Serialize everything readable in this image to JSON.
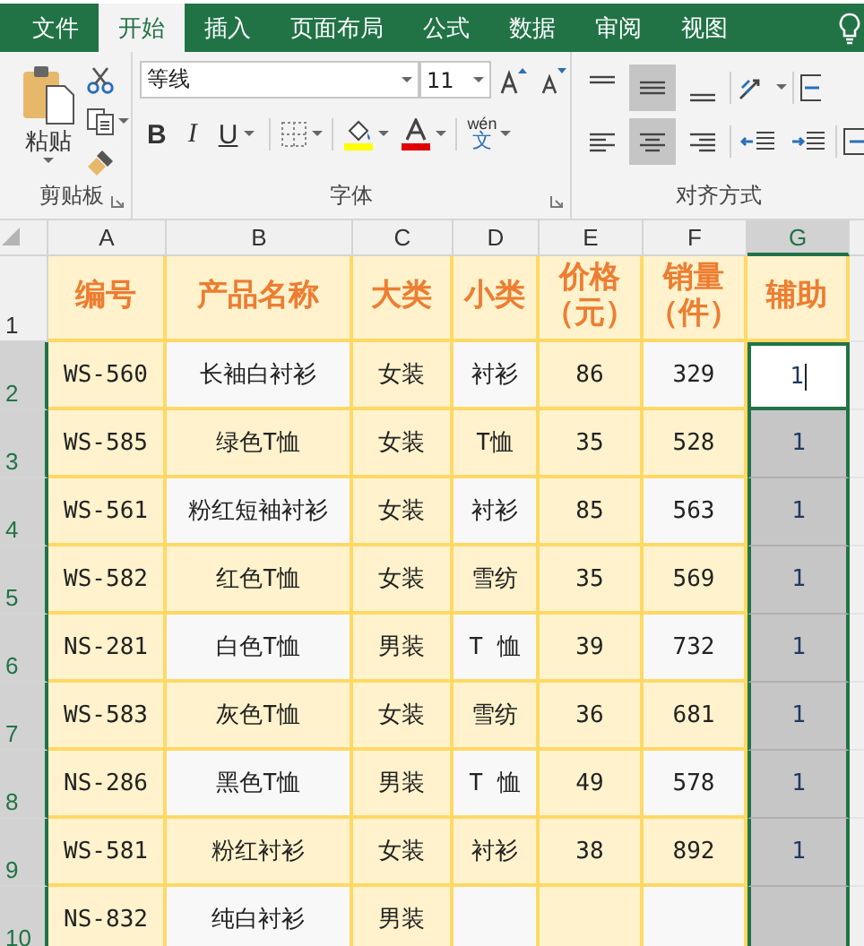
{
  "ribbon_tabs": [
    {
      "label": "文件",
      "selected": false
    },
    {
      "label": "开始",
      "selected": true
    },
    {
      "label": "插入",
      "selected": false
    },
    {
      "label": "页面布局",
      "selected": false
    },
    {
      "label": "公式",
      "selected": false
    },
    {
      "label": "数据",
      "selected": false
    },
    {
      "label": "审阅",
      "selected": false
    },
    {
      "label": "视图",
      "selected": false
    }
  ],
  "clipboard": {
    "paste_label": "粘贴",
    "group_label": "剪贴板"
  },
  "font": {
    "name": "等线",
    "size": "11",
    "bold": "B",
    "italic": "I",
    "underline": "U",
    "phonetic_top": "wén",
    "phonetic_bottom": "文",
    "group_label": "字体"
  },
  "alignment": {
    "vertical": [
      {
        "kind": "top",
        "selected": false
      },
      {
        "kind": "middle",
        "selected": true
      },
      {
        "kind": "bottom",
        "selected": false
      }
    ],
    "horizontal": [
      {
        "kind": "left",
        "selected": false
      },
      {
        "kind": "center",
        "selected": true
      },
      {
        "kind": "right",
        "selected": false
      }
    ],
    "group_label": "对齐方式"
  },
  "columns": [
    {
      "label": "A",
      "selected": false
    },
    {
      "label": "B",
      "selected": false
    },
    {
      "label": "C",
      "selected": false
    },
    {
      "label": "D",
      "selected": false
    },
    {
      "label": "E",
      "selected": false
    },
    {
      "label": "F",
      "selected": false
    },
    {
      "label": "G",
      "selected": true
    }
  ],
  "rows": [
    {
      "number": "1",
      "kind": "header",
      "selected": false,
      "active": false,
      "cells": [
        "编号",
        "产品名称",
        "大类",
        "小类",
        "价格（元）",
        "销量（件）",
        "辅助"
      ]
    },
    {
      "number": "2",
      "kind": "banded",
      "selected": true,
      "active": true,
      "cells": [
        "WS-560",
        "长袖白衬衫",
        "女装",
        "衬衫",
        "86",
        "329",
        "1"
      ]
    },
    {
      "number": "3",
      "kind": "plain",
      "selected": true,
      "active": false,
      "cells": [
        "WS-585",
        "绿色T恤",
        "女装",
        "T恤",
        "35",
        "528",
        "1"
      ]
    },
    {
      "number": "4",
      "kind": "banded",
      "selected": true,
      "active": false,
      "cells": [
        "WS-561",
        "粉红短袖衬衫",
        "女装",
        "衬衫",
        "85",
        "563",
        "1"
      ]
    },
    {
      "number": "5",
      "kind": "plain",
      "selected": true,
      "active": false,
      "cells": [
        "WS-582",
        "红色T恤",
        "女装",
        "雪纺",
        "35",
        "569",
        "1"
      ]
    },
    {
      "number": "6",
      "kind": "banded",
      "selected": true,
      "active": false,
      "cells": [
        "NS-281",
        "白色T恤",
        "男装",
        "T 恤",
        "39",
        "732",
        "1"
      ]
    },
    {
      "number": "7",
      "kind": "plain",
      "selected": true,
      "active": false,
      "cells": [
        "WS-583",
        "灰色T恤",
        "女装",
        "雪纺",
        "36",
        "681",
        "1"
      ]
    },
    {
      "number": "8",
      "kind": "banded",
      "selected": true,
      "active": false,
      "cells": [
        "NS-286",
        "黑色T恤",
        "男装",
        "T 恤",
        "49",
        "578",
        "1"
      ]
    },
    {
      "number": "9",
      "kind": "plain",
      "selected": true,
      "active": false,
      "cells": [
        "WS-581",
        "粉红衬衫",
        "女装",
        "衬衫",
        "38",
        "892",
        "1"
      ]
    },
    {
      "number": "10",
      "kind": "banded",
      "selected": true,
      "active": false,
      "cells": [
        "NS-832",
        "纯白衬衫",
        "男装"
      ]
    }
  ]
}
